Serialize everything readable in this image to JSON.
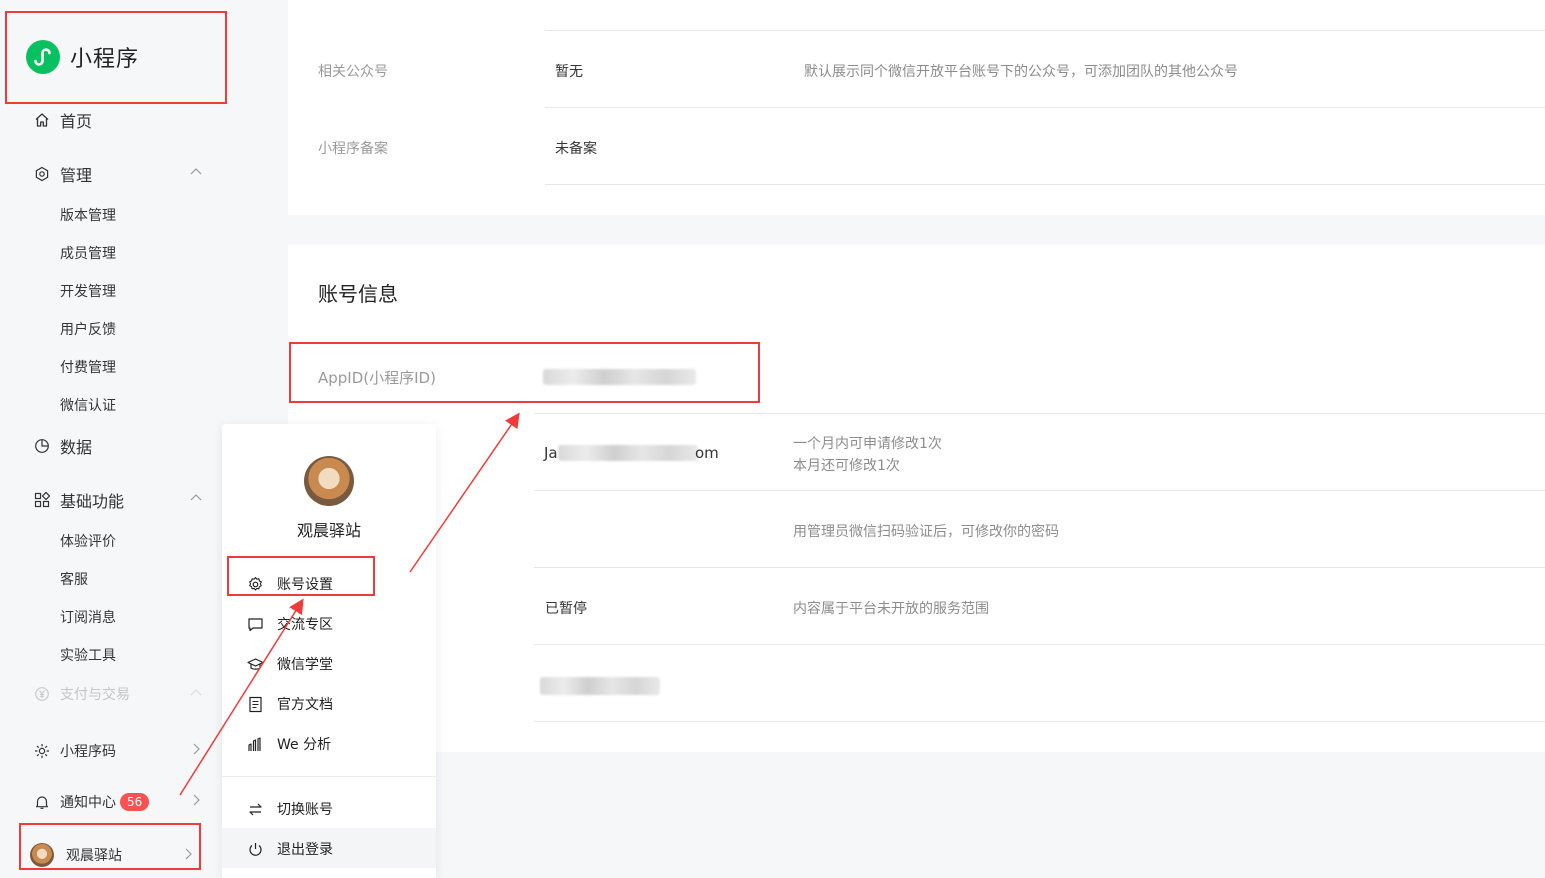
{
  "brand": {
    "title": "小程序",
    "accent": "#07c160"
  },
  "sidebar": {
    "home": {
      "label": "首页",
      "icon": "home-icon"
    },
    "manage": {
      "label": "管理",
      "icon": "settings-hex-icon",
      "items": [
        "版本管理",
        "成员管理",
        "开发管理",
        "用户反馈",
        "付费管理",
        "微信认证"
      ]
    },
    "data": {
      "label": "数据",
      "icon": "pie-chart-icon"
    },
    "basic": {
      "label": "基础功能",
      "icon": "grid-icon",
      "items": [
        "体验评价",
        "客服",
        "订阅消息",
        "实验工具"
      ]
    },
    "payment": {
      "label": "支付与交易",
      "icon": "yen-icon"
    },
    "qrcode": {
      "label": "小程序码",
      "icon": "sun-icon"
    },
    "notify": {
      "label": "通知中心",
      "icon": "bell-icon",
      "count": "56"
    },
    "account": {
      "label": "观晨驿站"
    }
  },
  "top_card": {
    "rows": [
      {
        "label": "相关公众号",
        "value": "暂无",
        "desc": "默认展示同个微信开放平台账号下的公众号，可添加团队的其他公众号"
      },
      {
        "label": "小程序备案",
        "value": "未备案",
        "desc": ""
      }
    ]
  },
  "account_card": {
    "title": "账号信息",
    "appid_label": "AppID(小程序ID)",
    "rows": [
      {
        "value_prefix": "Ja",
        "value_suffix": "om",
        "desc_line1": "一个月内可申请修改1次",
        "desc_line2": "本月还可修改1次"
      },
      {
        "desc": "用管理员微信扫码验证后，可修改你的密码"
      },
      {
        "value": "已暂停",
        "desc": "内容属于平台未开放的服务范围"
      }
    ]
  },
  "popup": {
    "name": "观晨驿站",
    "items": [
      {
        "label": "账号设置",
        "icon": "gear-icon"
      },
      {
        "label": "交流专区",
        "icon": "chat-icon"
      },
      {
        "label": "微信学堂",
        "icon": "graduation-cap-icon"
      },
      {
        "label": "官方文档",
        "icon": "document-icon"
      },
      {
        "label": "We 分析",
        "icon": "bars-icon"
      }
    ],
    "switch_label": "切换账号",
    "logout_label": "退出登录"
  },
  "annotation_color": "#f03b3b"
}
